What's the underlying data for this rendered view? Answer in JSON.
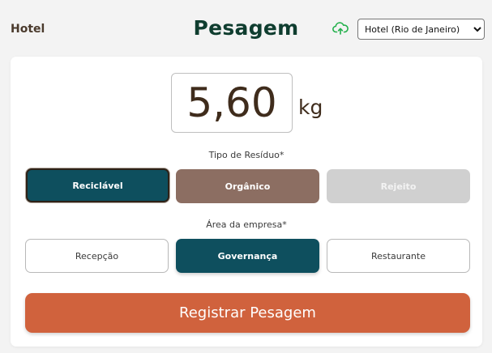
{
  "header": {
    "brand": "Hotel",
    "title": "Pesagem",
    "sync_icon": "cloud-upload-icon",
    "site_select": {
      "selected": "Hotel (Rio de Janeiro)"
    }
  },
  "weight": {
    "value": "5,60",
    "unit": "kg"
  },
  "waste_type": {
    "label": "Tipo de Resíduo*",
    "options": [
      {
        "label": "Reciclável",
        "selected": true
      },
      {
        "label": "Orgânico",
        "selected": false
      },
      {
        "label": "Rejeito",
        "selected": false,
        "disabled": true
      }
    ]
  },
  "area": {
    "label": "Área da empresa*",
    "options": [
      {
        "label": "Recepção",
        "selected": false
      },
      {
        "label": "Governança",
        "selected": true
      },
      {
        "label": "Restaurante",
        "selected": false
      }
    ]
  },
  "submit": {
    "label": "Registrar Pesagem"
  },
  "colors": {
    "accent_teal": "#0e4f5e",
    "organic_brown": "#8c6e62",
    "disabled_gray": "#d0d0d0",
    "submit_orange": "#d0623d",
    "sync_green": "#22b04b"
  }
}
